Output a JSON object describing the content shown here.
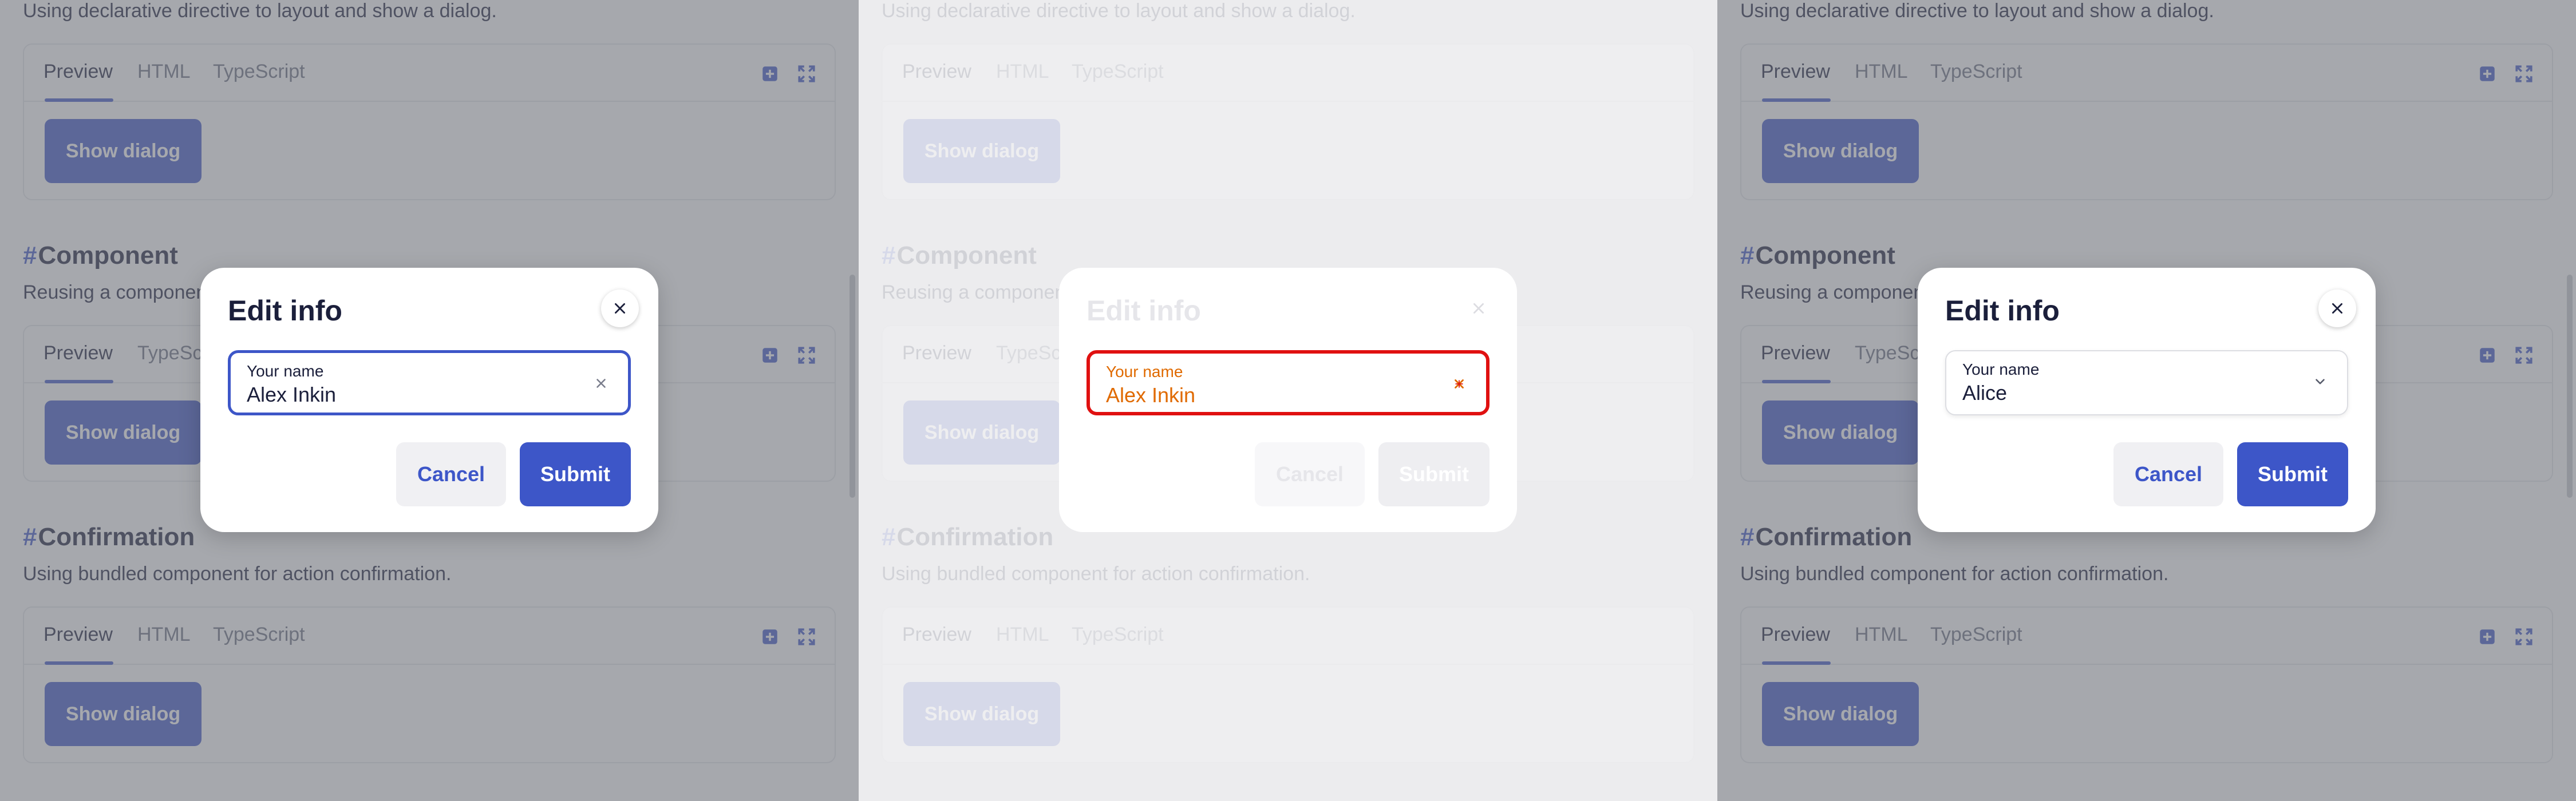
{
  "sections": {
    "intro_desc": "Using declarative directive to layout and show a dialog.",
    "component_heading": "Component",
    "component_desc": "Reusing a component",
    "confirmation_heading": "Confirmation",
    "confirmation_desc": "Using bundled component for action confirmation.",
    "hash": "#"
  },
  "demo_tabs": {
    "preview": "Preview",
    "html": "HTML",
    "typescript": "TypeScript"
  },
  "show_dialog_label": "Show dialog",
  "panels": [
    {
      "state": "text input focused",
      "dialog": {
        "title": "Edit info",
        "field_label": "Your name",
        "field_value": "Alex Inkin",
        "field_icon": "clear-icon",
        "cancel": "Cancel",
        "submit": "Submit"
      }
    },
    {
      "state": "difference highlight",
      "dialog": {
        "title": "Edit info",
        "field_label": "Your name",
        "field_value": "Alex Inkin",
        "field_icon": "clear-icon",
        "cancel": "Cancel",
        "submit": "Submit"
      }
    },
    {
      "state": "select",
      "dialog": {
        "title": "Edit info",
        "field_label": "Your name",
        "field_value": "Alice",
        "field_icon": "chevron-down-icon",
        "cancel": "Cancel",
        "submit": "Submit"
      }
    }
  ],
  "colors": {
    "accent": "#3d56c8",
    "text": "#1b1f3b",
    "error": "#e01010",
    "highlight": "#e06a00"
  }
}
